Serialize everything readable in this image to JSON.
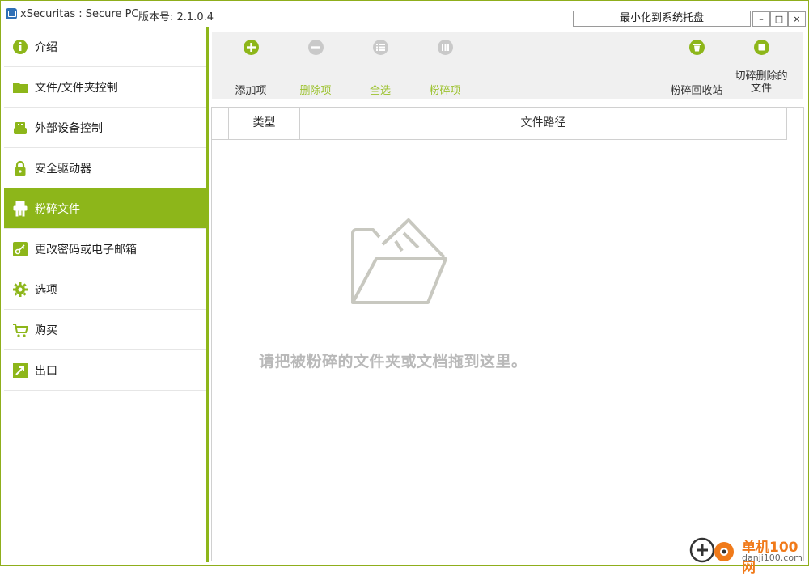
{
  "window": {
    "title": "xSecuritas : Secure PC",
    "version": "版本号: 2.1.0.4",
    "tray_button": "最小化到系统托盘",
    "min": "–",
    "max": "□",
    "close": "×"
  },
  "sidebar": {
    "items": [
      {
        "label": "介绍",
        "icon": "info-icon"
      },
      {
        "label": "文件/文件夹控制",
        "icon": "folder-icon"
      },
      {
        "label": "外部设备控制",
        "icon": "usb-icon"
      },
      {
        "label": "安全驱动器",
        "icon": "lock-icon"
      },
      {
        "label": "粉碎文件",
        "icon": "shredder-icon",
        "active": true
      },
      {
        "label": "更改密码或电子邮箱",
        "icon": "key-icon"
      },
      {
        "label": "选项",
        "icon": "gear-icon"
      },
      {
        "label": "购买",
        "icon": "cart-icon"
      },
      {
        "label": "出口",
        "icon": "exit-icon"
      }
    ]
  },
  "toolbar": {
    "add": "添加项",
    "remove": "删除项",
    "select_all": "全选",
    "shred": "粉碎项",
    "shred_recycle_bin": "粉碎回收站",
    "shred_deleted_1": "切碎删除的",
    "shred_deleted_2": "文件"
  },
  "table": {
    "col_type": "类型",
    "col_path": "文件路径",
    "drop_hint": "请把被粉碎的文件夹或文档拖到这里。"
  },
  "watermark": {
    "cn": "单机100网",
    "en": "danji100.com"
  },
  "colors": {
    "accent": "#8db61a",
    "disabled_label": "#9cc22e"
  }
}
